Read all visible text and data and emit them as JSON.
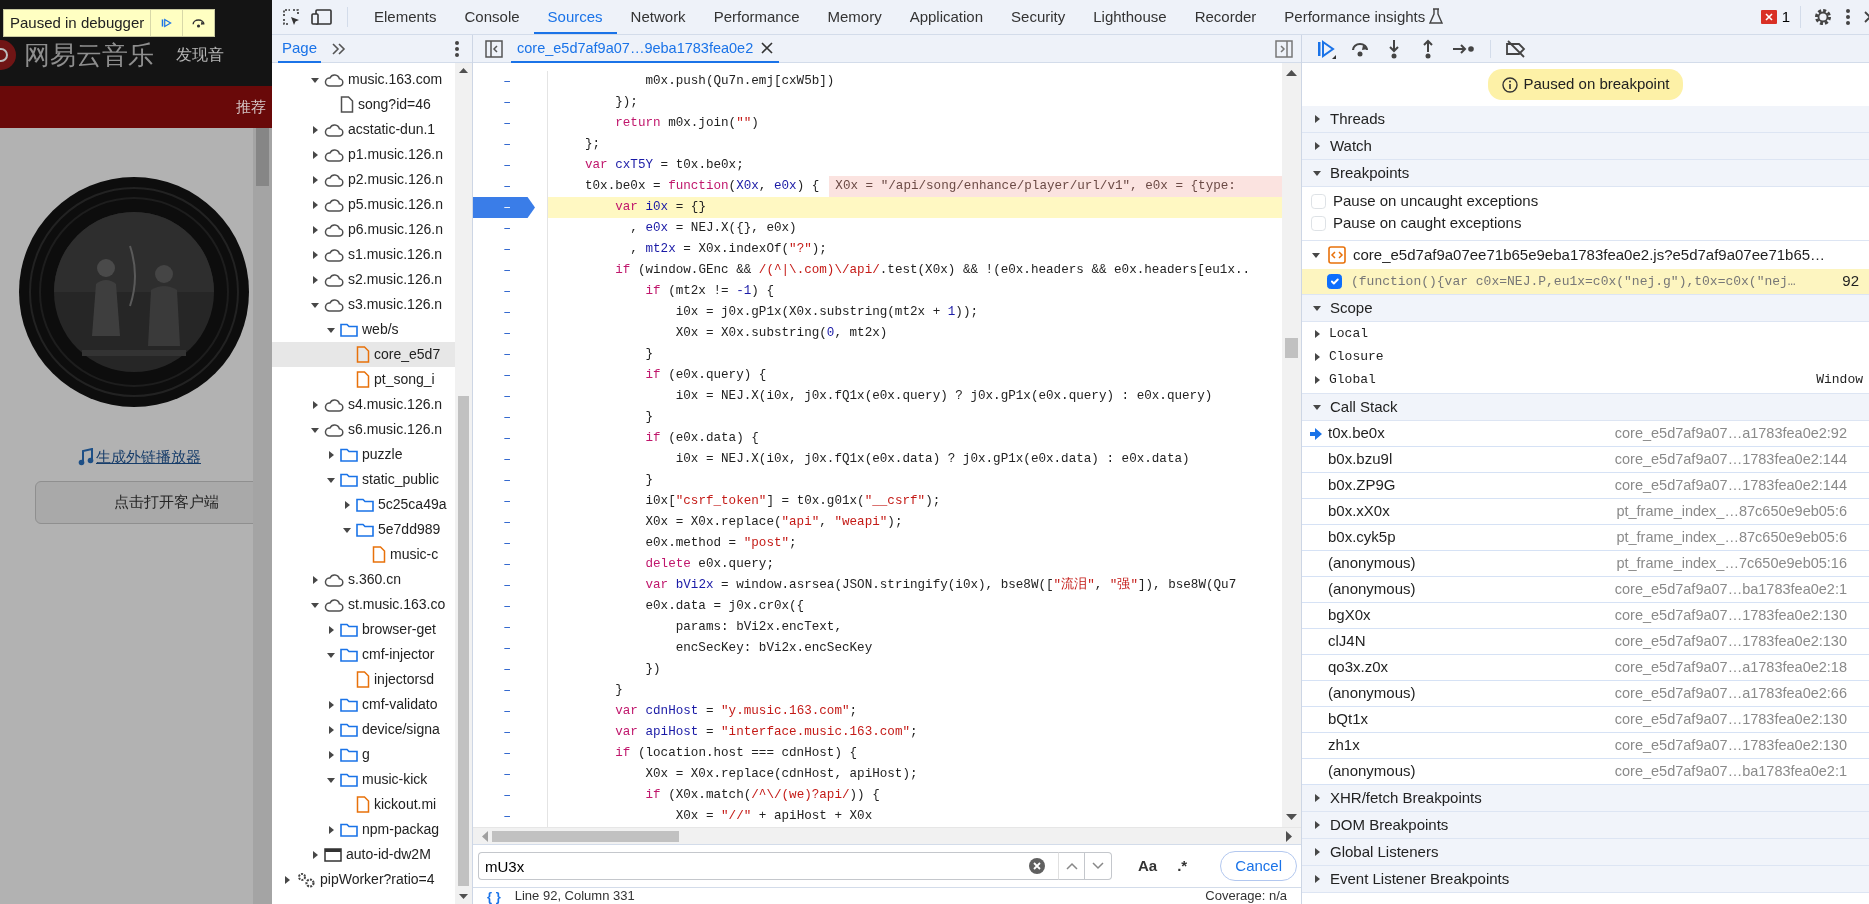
{
  "page": {
    "logo_text": "网易云音乐",
    "nav_text": "发现音",
    "nav_tab": "推荐",
    "embed_link": "生成外链播放器",
    "open_client_button": "点击打开客户端"
  },
  "paused_overlay": {
    "label": "Paused in debugger"
  },
  "devtools_tabs": [
    {
      "label": "Elements",
      "selected": false
    },
    {
      "label": "Console",
      "selected": false
    },
    {
      "label": "Sources",
      "selected": true
    },
    {
      "label": "Network",
      "selected": false
    },
    {
      "label": "Performance",
      "selected": false
    },
    {
      "label": "Memory",
      "selected": false
    },
    {
      "label": "Application",
      "selected": false
    },
    {
      "label": "Security",
      "selected": false
    },
    {
      "label": "Lighthouse",
      "selected": false
    },
    {
      "label": "Recorder",
      "selected": false
    },
    {
      "label": "Performance insights",
      "selected": false
    }
  ],
  "error_count": "1",
  "navigator_tabs": [
    {
      "label": "Page",
      "selected": true
    }
  ],
  "tree_items": [
    {
      "label": "music.163.com",
      "kind": "cloud",
      "expanded": true,
      "selected": false,
      "children": [
        {
          "label": "song?id=46",
          "kind": "document",
          "selected": false
        }
      ]
    },
    {
      "label": "acstatic-dun.1",
      "kind": "cloud",
      "expanded": false,
      "selected": false
    },
    {
      "label": "p1.music.126.n",
      "kind": "cloud",
      "expanded": false,
      "selected": false
    },
    {
      "label": "p2.music.126.n",
      "kind": "cloud",
      "expanded": false,
      "selected": false
    },
    {
      "label": "p5.music.126.n",
      "kind": "cloud",
      "expanded": false,
      "selected": false
    },
    {
      "label": "p6.music.126.n",
      "kind": "cloud",
      "expanded": false,
      "selected": false
    },
    {
      "label": "s1.music.126.n",
      "kind": "cloud",
      "expanded": false,
      "selected": false
    },
    {
      "label": "s2.music.126.n",
      "kind": "cloud",
      "expanded": false,
      "selected": false
    },
    {
      "label": "s3.music.126.n",
      "kind": "cloud",
      "expanded": true,
      "selected": false,
      "children": [
        {
          "label": "web/s",
          "kind": "folder",
          "expanded": true,
          "selected": false,
          "children": [
            {
              "label": "core_e5d7",
              "kind": "script",
              "selected": true
            },
            {
              "label": "pt_song_i",
              "kind": "script",
              "selected": false
            }
          ]
        }
      ]
    },
    {
      "label": "s4.music.126.n",
      "kind": "cloud",
      "expanded": false,
      "selected": false
    },
    {
      "label": "s6.music.126.n",
      "kind": "cloud",
      "expanded": true,
      "selected": false,
      "children": [
        {
          "label": "puzzle",
          "kind": "folder",
          "expanded": false,
          "selected": false
        },
        {
          "label": "static_public",
          "kind": "folder",
          "expanded": true,
          "selected": false,
          "children": [
            {
              "label": "5c25ca49a",
              "kind": "folder",
              "expanded": false,
              "selected": false
            },
            {
              "label": "5e7dd989",
              "kind": "folder",
              "expanded": true,
              "selected": false,
              "children": [
                {
                  "label": "music-c",
                  "kind": "script",
                  "selected": false
                }
              ]
            }
          ]
        }
      ]
    },
    {
      "label": "s.360.cn",
      "kind": "cloud",
      "expanded": false,
      "selected": false
    },
    {
      "label": "st.music.163.co",
      "kind": "cloud",
      "expanded": true,
      "selected": false,
      "children": [
        {
          "label": "browser-get",
          "kind": "folder",
          "expanded": false,
          "selected": false
        },
        {
          "label": "cmf-injector",
          "kind": "folder",
          "expanded": true,
          "selected": false,
          "children": [
            {
              "label": "injectorsd",
              "kind": "script",
              "selected": false
            }
          ]
        },
        {
          "label": "cmf-validato",
          "kind": "folder",
          "expanded": false,
          "selected": false
        },
        {
          "label": "device/signa",
          "kind": "folder",
          "expanded": false,
          "selected": false
        },
        {
          "label": "g",
          "kind": "folder",
          "expanded": false,
          "selected": false
        },
        {
          "label": "music-kick",
          "kind": "folder",
          "expanded": true,
          "selected": false,
          "children": [
            {
              "label": "kickout.mi",
              "kind": "script",
              "selected": false
            }
          ]
        },
        {
          "label": "npm-packag",
          "kind": "folder",
          "expanded": false,
          "selected": false
        }
      ]
    },
    {
      "label": "auto-id-dw2M",
      "kind": "frame",
      "expanded": false,
      "selected": false
    }
  ],
  "worker_items": [
    {
      "label": "pipWorker?ratio=4",
      "kind": "gears",
      "expanded": false,
      "selected": false
    }
  ],
  "editor": {
    "file_tabs": [
      {
        "label": "core_e5d7af9a07…9eba1783fea0e2",
        "selected": true
      }
    ],
    "lines": [
      {
        "gutter": "–",
        "breakpoint": false,
        "current": false,
        "tokens": [
          {
            "kind": "plain",
            "text": "        m0x.push(Qu7n.emj[cxW5b])"
          }
        ]
      },
      {
        "gutter": "–",
        "breakpoint": false,
        "current": false,
        "tokens": [
          {
            "kind": "plain",
            "text": "    });"
          }
        ]
      },
      {
        "gutter": "–",
        "breakpoint": false,
        "current": false,
        "tokens": [
          {
            "kind": "keyword",
            "text": "    return"
          },
          {
            "kind": "plain",
            "text": " m0x.join("
          },
          {
            "kind": "string",
            "text": "\"\""
          },
          {
            "kind": "plain",
            "text": ")"
          }
        ]
      },
      {
        "gutter": "–",
        "breakpoint": false,
        "current": false,
        "tokens": [
          {
            "kind": "plain",
            "text": "};"
          }
        ]
      },
      {
        "gutter": "–",
        "breakpoint": false,
        "current": false,
        "tokens": [
          {
            "kind": "keyword",
            "text": "var "
          },
          {
            "kind": "def",
            "text": "cxT5Y"
          },
          {
            "kind": "plain",
            "text": " = t0x.be0x;"
          }
        ]
      },
      {
        "gutter": "–",
        "breakpoint": false,
        "current": false,
        "tokens": [
          {
            "kind": "plain",
            "text": "t0x.be0x = "
          },
          {
            "kind": "keyword",
            "text": "function"
          },
          {
            "kind": "plain",
            "text": "("
          },
          {
            "kind": "def",
            "text": "X0x"
          },
          {
            "kind": "plain",
            "text": ", "
          },
          {
            "kind": "def",
            "text": "e0x"
          },
          {
            "kind": "plain",
            "text": ") {"
          }
        ],
        "inline_value": "X0x = \"/api/song/enhance/player/url/v1\", e0x = {type:"
      },
      {
        "gutter": "–",
        "breakpoint": true,
        "current": true,
        "tokens": [
          {
            "kind": "keyword",
            "text": "    var "
          },
          {
            "kind": "def",
            "text": "i0x"
          },
          {
            "kind": "plain",
            "text": " = {}"
          }
        ]
      },
      {
        "gutter": "–",
        "breakpoint": false,
        "current": false,
        "tokens": [
          {
            "kind": "plain",
            "text": "      , "
          },
          {
            "kind": "def",
            "text": "e0x"
          },
          {
            "kind": "plain",
            "text": " = NEJ.X({}, e0x)"
          }
        ]
      },
      {
        "gutter": "–",
        "breakpoint": false,
        "current": false,
        "tokens": [
          {
            "kind": "plain",
            "text": "      , "
          },
          {
            "kind": "def",
            "text": "mt2x"
          },
          {
            "kind": "plain",
            "text": " = X0x.indexOf("
          },
          {
            "kind": "string",
            "text": "\"?\""
          },
          {
            "kind": "plain",
            "text": ");"
          }
        ]
      },
      {
        "gutter": "–",
        "breakpoint": false,
        "current": false,
        "tokens": [
          {
            "kind": "keyword",
            "text": "    if"
          },
          {
            "kind": "plain",
            "text": " (window.GEnc && "
          },
          {
            "kind": "string",
            "text": "/(^|\\.com)\\/api/"
          },
          {
            "kind": "plain",
            "text": ".test(X0x) && !(e0x.headers && e0x.headers[eu1x.."
          }
        ]
      },
      {
        "gutter": "–",
        "breakpoint": false,
        "current": false,
        "tokens": [
          {
            "kind": "keyword",
            "text": "        if"
          },
          {
            "kind": "plain",
            "text": " (mt2x != "
          },
          {
            "kind": "number",
            "text": "-1"
          },
          {
            "kind": "plain",
            "text": ") {"
          }
        ]
      },
      {
        "gutter": "–",
        "breakpoint": false,
        "current": false,
        "tokens": [
          {
            "kind": "plain",
            "text": "            i0x = j0x.gP1x(X0x.substring(mt2x + "
          },
          {
            "kind": "number",
            "text": "1"
          },
          {
            "kind": "plain",
            "text": "));"
          }
        ]
      },
      {
        "gutter": "–",
        "breakpoint": false,
        "current": false,
        "tokens": [
          {
            "kind": "plain",
            "text": "            X0x = X0x.substring("
          },
          {
            "kind": "number",
            "text": "0"
          },
          {
            "kind": "plain",
            "text": ", mt2x)"
          }
        ]
      },
      {
        "gutter": "–",
        "breakpoint": false,
        "current": false,
        "tokens": [
          {
            "kind": "plain",
            "text": "        }"
          }
        ]
      },
      {
        "gutter": "–",
        "breakpoint": false,
        "current": false,
        "tokens": [
          {
            "kind": "keyword",
            "text": "        if"
          },
          {
            "kind": "plain",
            "text": " (e0x.query) {"
          }
        ]
      },
      {
        "gutter": "–",
        "breakpoint": false,
        "current": false,
        "tokens": [
          {
            "kind": "plain",
            "text": "            i0x = NEJ.X(i0x, j0x.fQ1x(e0x.query) ? j0x.gP1x(e0x.query) : e0x.query)"
          }
        ]
      },
      {
        "gutter": "–",
        "breakpoint": false,
        "current": false,
        "tokens": [
          {
            "kind": "plain",
            "text": "        }"
          }
        ]
      },
      {
        "gutter": "–",
        "breakpoint": false,
        "current": false,
        "tokens": [
          {
            "kind": "keyword",
            "text": "        if"
          },
          {
            "kind": "plain",
            "text": " (e0x.data) {"
          }
        ]
      },
      {
        "gutter": "–",
        "breakpoint": false,
        "current": false,
        "tokens": [
          {
            "kind": "plain",
            "text": "            i0x = NEJ.X(i0x, j0x.fQ1x(e0x.data) ? j0x.gP1x(e0x.data) : e0x.data)"
          }
        ]
      },
      {
        "gutter": "–",
        "breakpoint": false,
        "current": false,
        "tokens": [
          {
            "kind": "plain",
            "text": "        }"
          }
        ]
      },
      {
        "gutter": "–",
        "breakpoint": false,
        "current": false,
        "tokens": [
          {
            "kind": "plain",
            "text": "        i0x["
          },
          {
            "kind": "string",
            "text": "\"csrf_token\""
          },
          {
            "kind": "plain",
            "text": "] = t0x.g01x("
          },
          {
            "kind": "string",
            "text": "\"__csrf\""
          },
          {
            "kind": "plain",
            "text": ");"
          }
        ]
      },
      {
        "gutter": "–",
        "breakpoint": false,
        "current": false,
        "tokens": [
          {
            "kind": "plain",
            "text": "        X0x = X0x.replace("
          },
          {
            "kind": "string",
            "text": "\"api\""
          },
          {
            "kind": "plain",
            "text": ", "
          },
          {
            "kind": "string",
            "text": "\"weapi\""
          },
          {
            "kind": "plain",
            "text": ");"
          }
        ]
      },
      {
        "gutter": "–",
        "breakpoint": false,
        "current": false,
        "tokens": [
          {
            "kind": "plain",
            "text": "        e0x.method = "
          },
          {
            "kind": "string",
            "text": "\"post\""
          },
          {
            "kind": "plain",
            "text": ";"
          }
        ]
      },
      {
        "gutter": "–",
        "breakpoint": false,
        "current": false,
        "tokens": [
          {
            "kind": "keyword",
            "text": "        delete"
          },
          {
            "kind": "plain",
            "text": " e0x.query;"
          }
        ]
      },
      {
        "gutter": "–",
        "breakpoint": false,
        "current": false,
        "tokens": [
          {
            "kind": "keyword",
            "text": "        var "
          },
          {
            "kind": "def",
            "text": "bVi2x"
          },
          {
            "kind": "plain",
            "text": " = window.asrsea(JSON.stringify(i0x), bse8W(["
          },
          {
            "kind": "string",
            "text": "\"流泪\""
          },
          {
            "kind": "plain",
            "text": ", "
          },
          {
            "kind": "string",
            "text": "\"强\""
          },
          {
            "kind": "plain",
            "text": "]), bse8W(Qu7"
          }
        ]
      },
      {
        "gutter": "–",
        "breakpoint": false,
        "current": false,
        "tokens": [
          {
            "kind": "plain",
            "text": "        e0x.data = j0x.cr0x({"
          }
        ]
      },
      {
        "gutter": "–",
        "breakpoint": false,
        "current": false,
        "tokens": [
          {
            "kind": "plain",
            "text": "            params: bVi2x.encText,"
          }
        ]
      },
      {
        "gutter": "–",
        "breakpoint": false,
        "current": false,
        "tokens": [
          {
            "kind": "plain",
            "text": "            encSecKey: bVi2x.encSecKey"
          }
        ]
      },
      {
        "gutter": "–",
        "breakpoint": false,
        "current": false,
        "tokens": [
          {
            "kind": "plain",
            "text": "        })"
          }
        ]
      },
      {
        "gutter": "–",
        "breakpoint": false,
        "current": false,
        "tokens": [
          {
            "kind": "plain",
            "text": "    }"
          }
        ]
      },
      {
        "gutter": "–",
        "breakpoint": false,
        "current": false,
        "tokens": [
          {
            "kind": "keyword",
            "text": "    var "
          },
          {
            "kind": "def",
            "text": "cdnHost"
          },
          {
            "kind": "plain",
            "text": " = "
          },
          {
            "kind": "string",
            "text": "\"y.music.163.com\""
          },
          {
            "kind": "plain",
            "text": ";"
          }
        ]
      },
      {
        "gutter": "–",
        "breakpoint": false,
        "current": false,
        "tokens": [
          {
            "kind": "keyword",
            "text": "    var "
          },
          {
            "kind": "def",
            "text": "apiHost"
          },
          {
            "kind": "plain",
            "text": " = "
          },
          {
            "kind": "string",
            "text": "\"interface.music.163.com\""
          },
          {
            "kind": "plain",
            "text": ";"
          }
        ]
      },
      {
        "gutter": "–",
        "breakpoint": false,
        "current": false,
        "tokens": [
          {
            "kind": "keyword",
            "text": "    if"
          },
          {
            "kind": "plain",
            "text": " (location.host === cdnHost) {"
          }
        ]
      },
      {
        "gutter": "–",
        "breakpoint": false,
        "current": false,
        "tokens": [
          {
            "kind": "plain",
            "text": "        X0x = X0x.replace(cdnHost, apiHost);"
          }
        ]
      },
      {
        "gutter": "–",
        "breakpoint": false,
        "current": false,
        "tokens": [
          {
            "kind": "keyword",
            "text": "        if"
          },
          {
            "kind": "plain",
            "text": " (X0x.match("
          },
          {
            "kind": "string",
            "text": "/^\\/(we)?api/"
          },
          {
            "kind": "plain",
            "text": ")) {"
          }
        ]
      },
      {
        "gutter": "–",
        "breakpoint": false,
        "current": false,
        "tokens": [
          {
            "kind": "plain",
            "text": "            X0x = "
          },
          {
            "kind": "string",
            "text": "\"//\""
          },
          {
            "kind": "plain",
            "text": " + apiHost + X0x"
          }
        ]
      }
    ],
    "search": {
      "value": "mU3x",
      "case_button": "Aa",
      "regex_button": ".*",
      "cancel_button": "Cancel"
    },
    "status": {
      "pretty_print": "{ }",
      "position": "Line 92, Column 331",
      "coverage": "Coverage: n/a"
    }
  },
  "debugger": {
    "paused_message": "Paused on breakpoint",
    "sections_top": [
      {
        "title": "Threads",
        "expanded": false
      },
      {
        "title": "Watch",
        "expanded": false
      },
      {
        "title": "Breakpoints",
        "expanded": true
      }
    ],
    "exception_options": [
      {
        "label": "Pause on uncaught exceptions",
        "checked": false
      },
      {
        "label": "Pause on caught exceptions",
        "checked": false
      }
    ],
    "breakpoint_file": {
      "label": "core_e5d7af9a07ee71b65e9eba1783fea0e2.js?e5d7af9a07ee71b65…",
      "expanded": true
    },
    "breakpoints": [
      {
        "code": "(function(){var c0x=NEJ.P,eu1x=c0x(\"nej.g\"),t0x=c0x(\"nej…",
        "line": "92",
        "checked": true
      }
    ],
    "scope": {
      "title": "Scope",
      "expanded": true,
      "items": [
        {
          "name": "Local",
          "expanded": false
        },
        {
          "name": "Closure",
          "expanded": false
        },
        {
          "name": "Global",
          "expanded": false,
          "value": "Window"
        }
      ]
    },
    "call_stack": {
      "title": "Call Stack",
      "expanded": true,
      "frames": [
        {
          "name": "t0x.be0x",
          "location": "core_e5d7af9a07…a1783fea0e2:92",
          "current": true
        },
        {
          "name": "b0x.bzu9l",
          "location": "core_e5d7af9a07…1783fea0e2:144",
          "current": false
        },
        {
          "name": "b0x.ZP9G",
          "location": "core_e5d7af9a07…1783fea0e2:144",
          "current": false
        },
        {
          "name": "b0x.xX0x",
          "location": "pt_frame_index_…87c650e9eb05:6",
          "current": false
        },
        {
          "name": "b0x.cyk5p",
          "location": "pt_frame_index_…87c650e9eb05:6",
          "current": false
        },
        {
          "name": "(anonymous)",
          "location": "pt_frame_index_…7c650e9eb05:16",
          "current": false
        },
        {
          "name": "(anonymous)",
          "location": "core_e5d7af9a07…ba1783fea0e2:1",
          "current": false
        },
        {
          "name": "bgX0x",
          "location": "core_e5d7af9a07…1783fea0e2:130",
          "current": false
        },
        {
          "name": "clJ4N",
          "location": "core_e5d7af9a07…1783fea0e2:130",
          "current": false
        },
        {
          "name": "qo3x.z0x",
          "location": "core_e5d7af9a07…a1783fea0e2:18",
          "current": false
        },
        {
          "name": "(anonymous)",
          "location": "core_e5d7af9a07…a1783fea0e2:66",
          "current": false
        },
        {
          "name": "bQt1x",
          "location": "core_e5d7af9a07…1783fea0e2:130",
          "current": false
        },
        {
          "name": "zh1x",
          "location": "core_e5d7af9a07…1783fea0e2:130",
          "current": false
        },
        {
          "name": "(anonymous)",
          "location": "core_e5d7af9a07…ba1783fea0e2:1",
          "current": false
        }
      ]
    },
    "sections_bottom": [
      {
        "title": "XHR/fetch Breakpoints",
        "expanded": false
      },
      {
        "title": "DOM Breakpoints",
        "expanded": false
      },
      {
        "title": "Global Listeners",
        "expanded": false
      },
      {
        "title": "Event Listener Breakpoints",
        "expanded": false
      }
    ]
  }
}
